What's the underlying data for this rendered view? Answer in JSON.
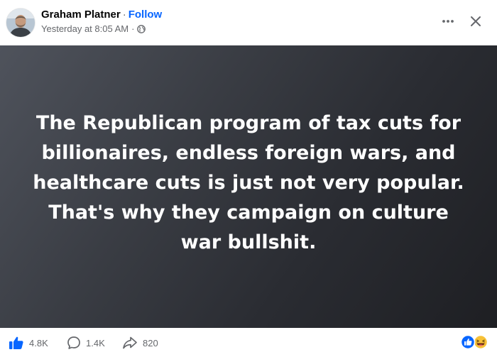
{
  "post": {
    "author": "Graham Platner",
    "follow_label": "Follow",
    "separator": "·",
    "timestamp": "Yesterday at 8:05 AM",
    "audience_icon": "globe-icon",
    "text": "The Republican program of tax cuts for billionaires, endless foreign wars, and healthcare cuts is just not very popular. That's why they campaign on culture war bullshit.",
    "background_colors": [
      "#4f535c",
      "#1e1f23"
    ]
  },
  "stats": {
    "likes": "4.8K",
    "comments": "1.4K",
    "shares": "820"
  },
  "reactions": [
    "like-reaction-icon",
    "haha-reaction-icon"
  ],
  "colors": {
    "accent": "#0866ff",
    "secondary_text": "#65676b"
  }
}
